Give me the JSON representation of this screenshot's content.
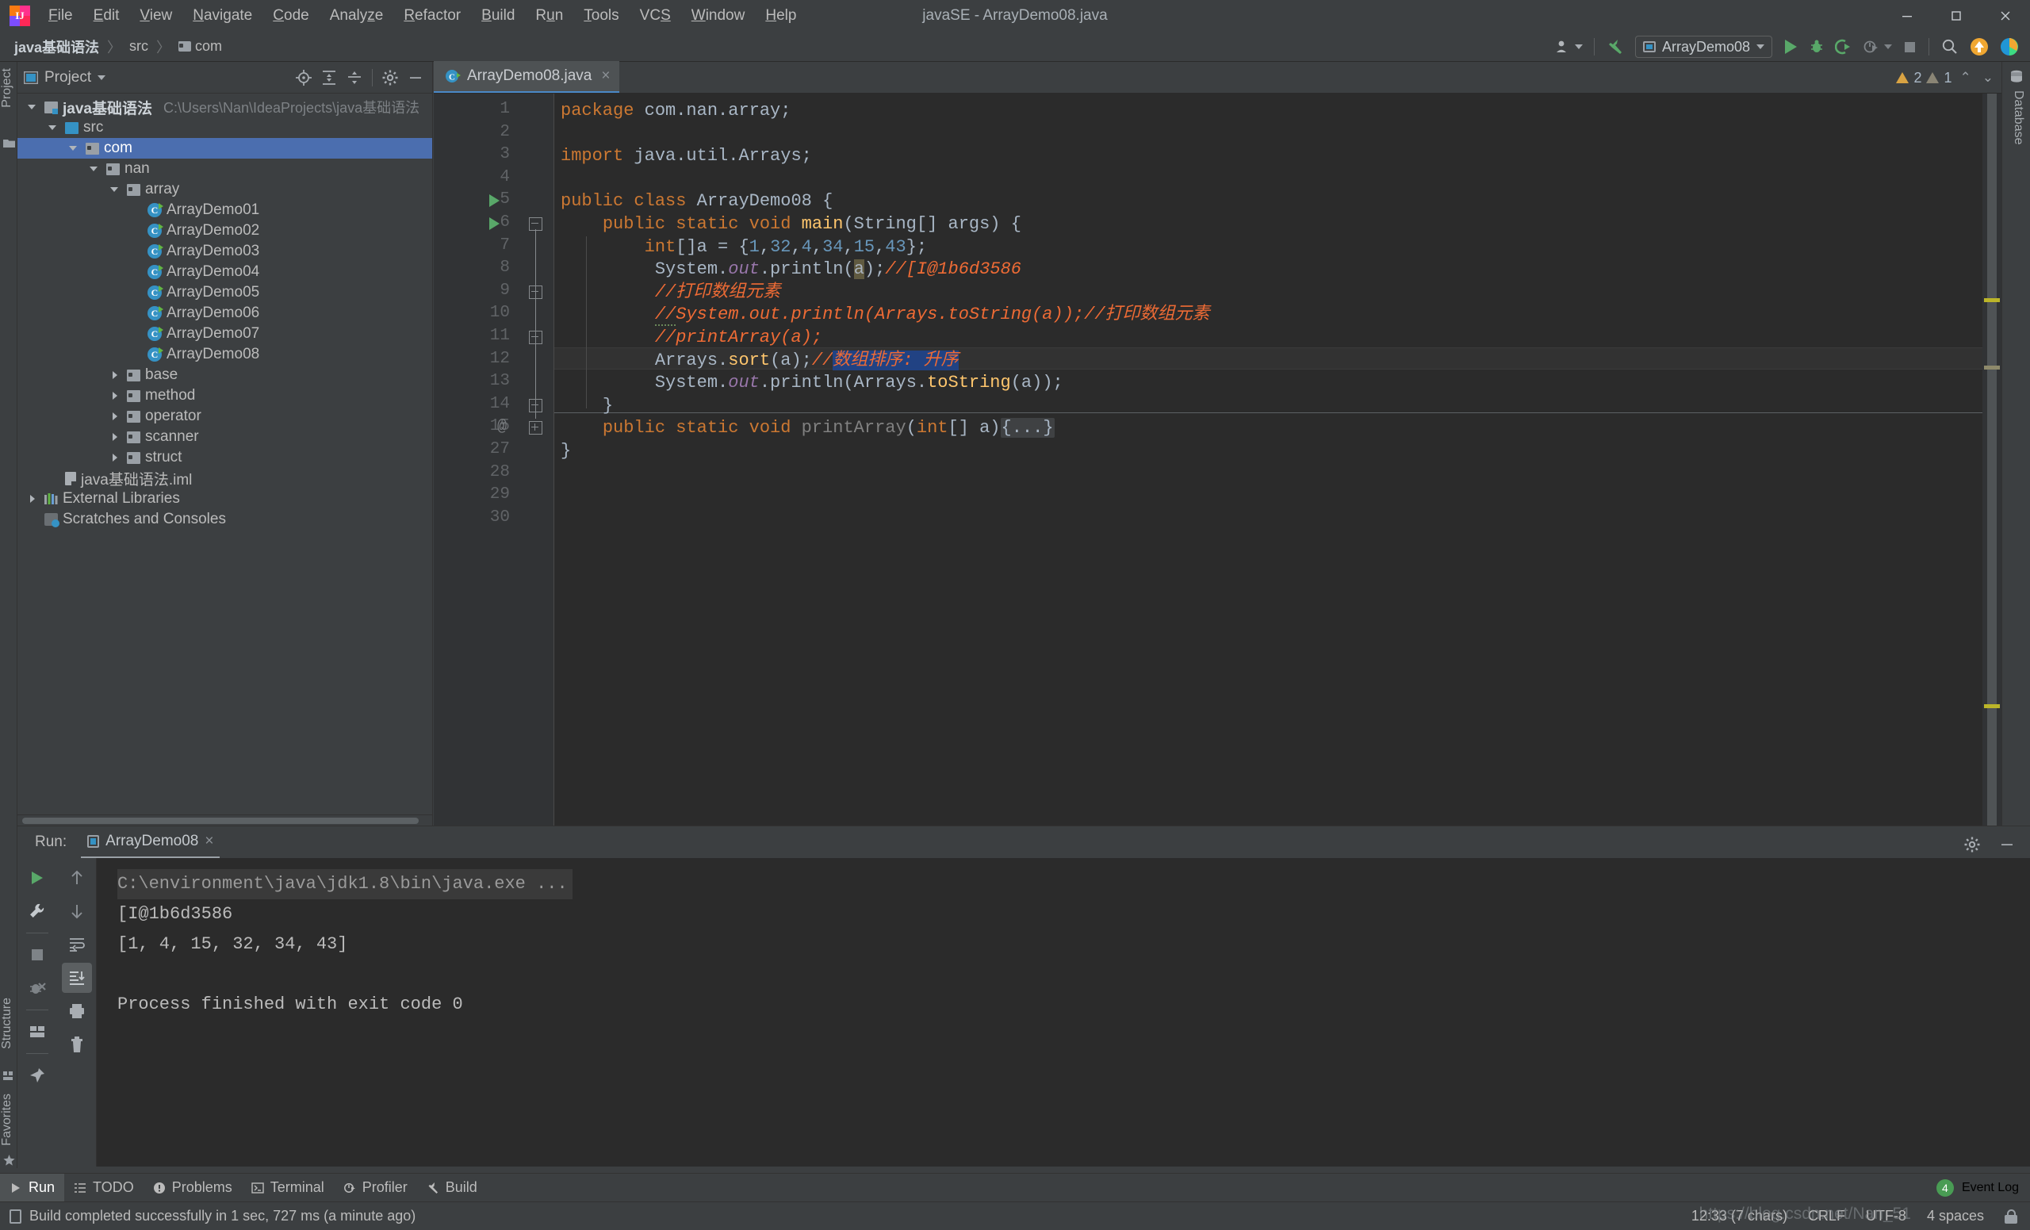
{
  "window": {
    "title": "javaSE - ArrayDemo08.java",
    "minimize_label": "Minimize",
    "maximize_label": "Maximize",
    "close_label": "Close"
  },
  "menu": [
    {
      "label": "File",
      "mnemonic": "F"
    },
    {
      "label": "Edit",
      "mnemonic": "E"
    },
    {
      "label": "View",
      "mnemonic": "V"
    },
    {
      "label": "Navigate",
      "mnemonic": "N"
    },
    {
      "label": "Code",
      "mnemonic": "C"
    },
    {
      "label": "Analyze",
      "mnemonic": "z"
    },
    {
      "label": "Refactor",
      "mnemonic": "R"
    },
    {
      "label": "Build",
      "mnemonic": "B"
    },
    {
      "label": "Run",
      "mnemonic": "u"
    },
    {
      "label": "Tools",
      "mnemonic": "T"
    },
    {
      "label": "VCS",
      "mnemonic": "S"
    },
    {
      "label": "Window",
      "mnemonic": "W"
    },
    {
      "label": "Help",
      "mnemonic": "H"
    }
  ],
  "breadcrumbs": [
    {
      "label": "java基础语法",
      "type": "project"
    },
    {
      "label": "src",
      "type": "source"
    },
    {
      "label": "com",
      "type": "package"
    }
  ],
  "toolbar": {
    "run_configuration": "ArrayDemo08",
    "run_label": "Run",
    "debug_label": "Debug",
    "run_coverage_label": "Run with Coverage",
    "profile_label": "Profile",
    "stop_label": "Stop",
    "search_label": "Search Everywhere",
    "update_label": "Update Project",
    "ide_label": "IDE and Project Settings"
  },
  "left_rail": {
    "project_label": "Project",
    "structure_label": "Structure",
    "favorites_label": "Favorites"
  },
  "right_rail": {
    "database_label": "Database"
  },
  "project_panel": {
    "title": "Project",
    "tools": [
      "locate-icon",
      "expand-all-icon",
      "collapse-all-icon",
      "settings-icon",
      "hide-icon"
    ],
    "tree": [
      {
        "label": "java基础语法",
        "path": "C:\\Users\\Nan\\IdeaProjects\\java基础语法",
        "indent": 0,
        "twist": "open",
        "icon": "module",
        "bold": true,
        "selected": false
      },
      {
        "label": "src",
        "path": "",
        "indent": 1,
        "twist": "open",
        "icon": "srcfolder",
        "bold": false,
        "selected": false
      },
      {
        "label": "com",
        "path": "",
        "indent": 2,
        "twist": "open",
        "icon": "pkg",
        "bold": false,
        "selected": true
      },
      {
        "label": "nan",
        "path": "",
        "indent": 3,
        "twist": "open",
        "icon": "pkg",
        "bold": false,
        "selected": false
      },
      {
        "label": "array",
        "path": "",
        "indent": 4,
        "twist": "open",
        "icon": "pkg",
        "bold": false,
        "selected": false
      },
      {
        "label": "ArrayDemo01",
        "path": "",
        "indent": 5,
        "twist": "none",
        "icon": "javacls",
        "bold": false,
        "selected": false
      },
      {
        "label": "ArrayDemo02",
        "path": "",
        "indent": 5,
        "twist": "none",
        "icon": "javacls",
        "bold": false,
        "selected": false
      },
      {
        "label": "ArrayDemo03",
        "path": "",
        "indent": 5,
        "twist": "none",
        "icon": "javacls",
        "bold": false,
        "selected": false
      },
      {
        "label": "ArrayDemo04",
        "path": "",
        "indent": 5,
        "twist": "none",
        "icon": "javacls",
        "bold": false,
        "selected": false
      },
      {
        "label": "ArrayDemo05",
        "path": "",
        "indent": 5,
        "twist": "none",
        "icon": "javacls",
        "bold": false,
        "selected": false
      },
      {
        "label": "ArrayDemo06",
        "path": "",
        "indent": 5,
        "twist": "none",
        "icon": "javacls",
        "bold": false,
        "selected": false
      },
      {
        "label": "ArrayDemo07",
        "path": "",
        "indent": 5,
        "twist": "none",
        "icon": "javacls",
        "bold": false,
        "selected": false
      },
      {
        "label": "ArrayDemo08",
        "path": "",
        "indent": 5,
        "twist": "none",
        "icon": "javacls",
        "bold": false,
        "selected": false
      },
      {
        "label": "base",
        "path": "",
        "indent": 4,
        "twist": "closed",
        "icon": "pkg",
        "bold": false,
        "selected": false
      },
      {
        "label": "method",
        "path": "",
        "indent": 4,
        "twist": "closed",
        "icon": "pkg",
        "bold": false,
        "selected": false
      },
      {
        "label": "operator",
        "path": "",
        "indent": 4,
        "twist": "closed",
        "icon": "pkg",
        "bold": false,
        "selected": false
      },
      {
        "label": "scanner",
        "path": "",
        "indent": 4,
        "twist": "closed",
        "icon": "pkg",
        "bold": false,
        "selected": false
      },
      {
        "label": "struct",
        "path": "",
        "indent": 4,
        "twist": "closed",
        "icon": "pkg",
        "bold": false,
        "selected": false
      },
      {
        "label": "java基础语法.iml",
        "path": "",
        "indent": 1,
        "twist": "none",
        "icon": "iml",
        "bold": false,
        "selected": false
      },
      {
        "label": "External Libraries",
        "path": "",
        "indent": 0,
        "twist": "closed",
        "icon": "lib",
        "bold": false,
        "selected": false
      },
      {
        "label": "Scratches and Consoles",
        "path": "",
        "indent": 0,
        "twist": "none",
        "icon": "scratch",
        "bold": false,
        "selected": false
      }
    ]
  },
  "editor": {
    "tab": {
      "label": "ArrayDemo08.java",
      "close": "×"
    },
    "inspections": {
      "warning_count": "2",
      "weak_warning_count": "1",
      "prev": "⌃",
      "next": "⌄"
    },
    "line_numbers": [
      "1",
      "2",
      "3",
      "4",
      "5",
      "6",
      "7",
      "8",
      "9",
      "10",
      "11",
      "12",
      "13",
      "14",
      "15",
      "27",
      "28",
      "29",
      "30"
    ],
    "code_lines": [
      {
        "n": "1",
        "text": "package com.nan.array;"
      },
      {
        "n": "2",
        "text": ""
      },
      {
        "n": "3",
        "text": "import java.util.Arrays;"
      },
      {
        "n": "4",
        "text": ""
      },
      {
        "n": "5",
        "text": "public class ArrayDemo08 {"
      },
      {
        "n": "6",
        "text": "    public static void main(String[] args) {"
      },
      {
        "n": "7",
        "text": "        int[]a = {1,32,4,34,15,43};"
      },
      {
        "n": "8",
        "text": "         System.out.println(a);//[I@1b6d3586"
      },
      {
        "n": "9",
        "text": "         //打印数组元素"
      },
      {
        "n": "10",
        "text": "         //System.out.println(Arrays.toString(a));//打印数组元素"
      },
      {
        "n": "11",
        "text": "         //printArray(a);"
      },
      {
        "n": "12",
        "text": "         Arrays.sort(a);//数组排序: 升序"
      },
      {
        "n": "13",
        "text": "         System.out.println(Arrays.toString(a));"
      },
      {
        "n": "14",
        "text": "    }"
      },
      {
        "n": "15",
        "text": "    public static void printArray(int[] a){...}"
      },
      {
        "n": "27",
        "text": "}"
      },
      {
        "n": "28",
        "text": ""
      },
      {
        "n": "29",
        "text": ""
      },
      {
        "n": "30",
        "text": ""
      }
    ],
    "selected_text": "数组排序: 升序"
  },
  "run_panel": {
    "label": "Run:",
    "tab": "ArrayDemo08",
    "tab_close": "×",
    "settings_label": "Settings",
    "hide_label": "Hide",
    "tools_left": [
      "rerun-icon",
      "edit-configuration-icon",
      "stop-icon",
      "kill-process-icon",
      "layout-icon",
      "pin-icon"
    ],
    "tools_right": [
      "up-arrow-icon",
      "down-arrow-icon",
      "soft-wrap-icon",
      "scroll-to-end-icon",
      "print-icon",
      "trash-icon"
    ],
    "console": [
      {
        "text": "C:\\environment\\java\\jdk1.8\\bin\\java.exe ...",
        "type": "command"
      },
      {
        "text": "[I@1b6d3586",
        "type": "output"
      },
      {
        "text": "[1, 4, 15, 32, 34, 43]",
        "type": "output"
      },
      {
        "text": "",
        "type": "output"
      },
      {
        "text": "Process finished with exit code 0",
        "type": "output"
      }
    ]
  },
  "toolwindow_bar": {
    "items": [
      {
        "label": "Run",
        "icon": "run-icon",
        "active": true
      },
      {
        "label": "TODO",
        "icon": "todo-icon",
        "active": false
      },
      {
        "label": "Problems",
        "icon": "problems-icon",
        "active": false
      },
      {
        "label": "Terminal",
        "icon": "terminal-icon",
        "active": false
      },
      {
        "label": "Profiler",
        "icon": "profiler-icon",
        "active": false
      },
      {
        "label": "Build",
        "icon": "build-icon",
        "active": false
      }
    ],
    "event_log": {
      "label": "Event Log",
      "count": "4"
    }
  },
  "statusbar": {
    "message": "Build completed successfully in 1 sec, 727 ms (a minute ago)",
    "position": "12:33 (7 chars)",
    "line_separator": "CRLF",
    "encoding": "UTF-8",
    "indent": "4 spaces",
    "lock": "lock-icon"
  },
  "watermark": "https://blog.csdn.net/Nan_51",
  "colors": {
    "accent_blue": "#4b6eaf",
    "selection_blue": "#214283",
    "keyword_orange": "#cc7832",
    "comment_orange": "#ee6b35",
    "number_blue": "#6897bb",
    "field_purple": "#9876aa",
    "method_yellow": "#ffc66d",
    "green_run": "#59a869",
    "warning_yellow": "#d9a343",
    "editor_bg": "#2b2b2b",
    "panel_bg": "#3c3f41"
  }
}
